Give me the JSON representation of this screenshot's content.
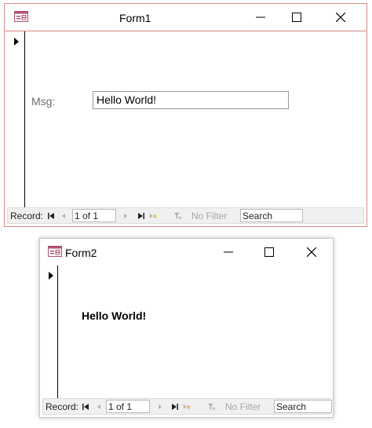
{
  "form1": {
    "title": "Form1",
    "field_label": "Msg:",
    "field_value": "Hello World!",
    "nav": {
      "record_label": "Record:",
      "record_value": "1 of 1",
      "filter_label": "No Filter",
      "search_value": "Search"
    }
  },
  "form2": {
    "title": "Form2",
    "message": "Hello World!",
    "nav": {
      "record_label": "Record:",
      "record_value": "1 of 1",
      "filter_label": "No Filter",
      "search_value": "Search"
    }
  },
  "colors": {
    "form1_border": "#d98a88",
    "app_icon": "#b0506e"
  },
  "icons": [
    "app-icon",
    "minimize-icon",
    "maximize-icon",
    "close-icon",
    "record-selector-arrow",
    "first-record-icon",
    "prev-record-icon",
    "next-record-icon",
    "last-record-icon",
    "new-record-icon",
    "filter-icon"
  ]
}
